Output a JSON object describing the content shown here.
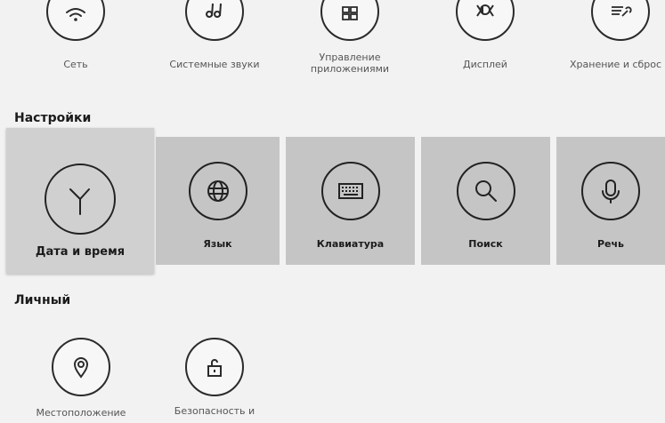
{
  "top_row": {
    "items": [
      {
        "label": "Сеть",
        "icon": "wifi-icon"
      },
      {
        "label": "Системные звуки",
        "icon": "sound-icon"
      },
      {
        "label": "Управление приложениями",
        "icon": "apps-icon"
      },
      {
        "label": "Дисплей",
        "icon": "display-icon"
      },
      {
        "label": "Хранение и сброс",
        "icon": "storage-icon"
      }
    ]
  },
  "settings_section": {
    "title": "Настройки",
    "tiles": [
      {
        "label": "Дата и время",
        "icon": "clock-icon",
        "focused": true
      },
      {
        "label": "Язык",
        "icon": "globe-icon"
      },
      {
        "label": "Клавиатура",
        "icon": "keyboard-icon"
      },
      {
        "label": "Поиск",
        "icon": "search-icon"
      },
      {
        "label": "Речь",
        "icon": "microphone-icon"
      }
    ]
  },
  "personal_section": {
    "title": "Личный",
    "items": [
      {
        "label": "Местоположение",
        "icon": "location-icon"
      },
      {
        "label": "Безопасность и",
        "icon": "lock-icon"
      }
    ]
  }
}
